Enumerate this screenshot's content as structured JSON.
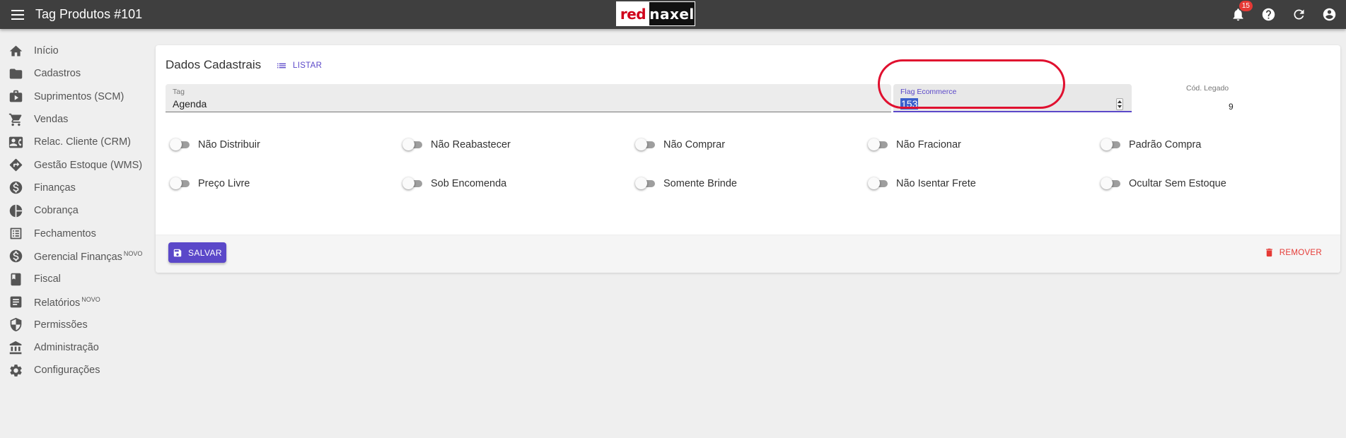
{
  "header": {
    "title": "Tag Produtos #101",
    "logo": {
      "part1": "red",
      "part2": "naxel"
    },
    "notification_count": "15",
    "icons": [
      "menu-icon",
      "bell-icon",
      "help-icon",
      "refresh-icon",
      "account-icon"
    ]
  },
  "sidebar": {
    "items": [
      {
        "label": "Início",
        "icon": "home-icon",
        "tag": ""
      },
      {
        "label": "Cadastros",
        "icon": "folder-icon",
        "tag": ""
      },
      {
        "label": "Suprimentos (SCM)",
        "icon": "shopping-bag-icon",
        "tag": ""
      },
      {
        "label": "Vendas",
        "icon": "cart-icon",
        "tag": ""
      },
      {
        "label": "Relac. Cliente (CRM)",
        "icon": "contact-card-icon",
        "tag": ""
      },
      {
        "label": "Gestão Estoque (WMS)",
        "icon": "directions-icon",
        "tag": ""
      },
      {
        "label": "Finanças",
        "icon": "dollar-circle-icon",
        "tag": ""
      },
      {
        "label": "Cobrança",
        "icon": "pie-chart-icon",
        "tag": ""
      },
      {
        "label": "Fechamentos",
        "icon": "list-alt-icon",
        "tag": ""
      },
      {
        "label": "Gerencial Finanças",
        "icon": "dollar-circle-icon",
        "tag": "NOVO"
      },
      {
        "label": "Fiscal",
        "icon": "book-icon",
        "tag": ""
      },
      {
        "label": "Relatórios",
        "icon": "article-icon",
        "tag": "NOVO"
      },
      {
        "label": "Permissões",
        "icon": "shield-icon",
        "tag": ""
      },
      {
        "label": "Administração",
        "icon": "bank-icon",
        "tag": ""
      },
      {
        "label": "Configurações",
        "icon": "gear-icon",
        "tag": ""
      }
    ]
  },
  "form": {
    "title": "Dados Cadastrais",
    "list_label": "LISTAR",
    "tag": {
      "label": "Tag",
      "value": "Agenda"
    },
    "flag_ecommerce": {
      "label": "Flag Ecommerce",
      "value": "153"
    },
    "legacy_code": {
      "label": "Cód. Legado",
      "value": "9"
    },
    "toggles": [
      {
        "label": "Não Distribuir",
        "on": false
      },
      {
        "label": "Não Reabastecer",
        "on": false
      },
      {
        "label": "Não Comprar",
        "on": false
      },
      {
        "label": "Não Fracionar",
        "on": false
      },
      {
        "label": "Padrão Compra",
        "on": false
      },
      {
        "label": "Preço Livre",
        "on": false
      },
      {
        "label": "Sob Encomenda",
        "on": false
      },
      {
        "label": "Somente Brinde",
        "on": false
      },
      {
        "label": "Não Isentar Frete",
        "on": false
      },
      {
        "label": "Ocultar Sem Estoque",
        "on": false
      }
    ],
    "save_label": "SALVAR",
    "remove_label": "REMOVER"
  },
  "colors": {
    "topbar": "#3f3f3f",
    "accent": "#5b48c9",
    "danger": "#e53935",
    "highlight_ring": "#e0102f"
  }
}
